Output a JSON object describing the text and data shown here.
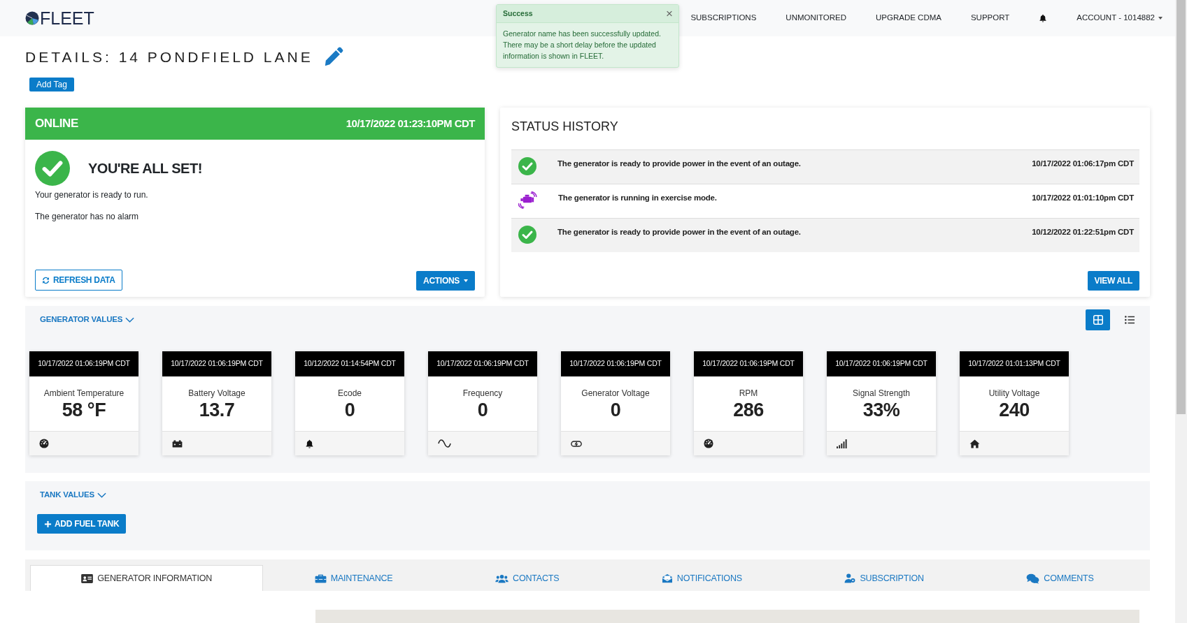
{
  "header": {
    "logo_text": "FLEET",
    "nav": [
      {
        "kind": "link",
        "label": "SUBSCRIPTIONS"
      },
      {
        "kind": "link",
        "label": "UNMONITORED"
      },
      {
        "kind": "link",
        "label": "UPGRADE CDMA"
      },
      {
        "kind": "link",
        "label": "SUPPORT"
      },
      {
        "kind": "bell"
      },
      {
        "kind": "dropdown",
        "label": "ACCOUNT - 1014882"
      }
    ]
  },
  "toast": {
    "title": "Success",
    "close": "×",
    "message": "Generator name has been successfully updated. There may be a short delay before the updated information is shown in FLEET."
  },
  "page": {
    "title": "DETAILS: 14 PONDFIELD LANE",
    "add_tag_button": "Add Tag"
  },
  "status_card": {
    "status": "ONLINE",
    "timestamp": "10/17/2022 01:23:10PM CDT",
    "headline": "YOU'RE ALL SET!",
    "messages": [
      "Your generator is ready to run.",
      "The generator has no alarm"
    ],
    "refresh_button": "REFRESH DATA",
    "actions_button": "ACTIONS"
  },
  "status_history": {
    "title": "STATUS HISTORY",
    "rows": [
      {
        "kind": "ready",
        "message": "The generator is ready to provide power in the event of an outage.",
        "time": "10/17/2022 01:06:17pm CDT"
      },
      {
        "kind": "exercise",
        "message": "The generator is running in exercise mode.",
        "time": "10/17/2022 01:01:10pm CDT"
      },
      {
        "kind": "ready",
        "message": "The generator is ready to provide power in the event of an outage.",
        "time": "10/12/2022 01:22:51pm CDT"
      }
    ],
    "view_all_button": "VIEW ALL"
  },
  "generator_values": {
    "title": "GENERATOR VALUES",
    "view_modes": [
      {
        "kind": "grid",
        "selected": true
      },
      {
        "kind": "list",
        "selected": false
      }
    ],
    "tiles": [
      {
        "kind": "gauge",
        "timestamp": "10/17/2022 01:06:19PM CDT",
        "label": "Ambient Temperature",
        "value": "58 °F"
      },
      {
        "kind": "battery",
        "timestamp": "10/17/2022 01:06:19PM CDT",
        "label": "Battery Voltage",
        "value": "13.7"
      },
      {
        "kind": "bell",
        "timestamp": "10/12/2022 01:14:54PM CDT",
        "label": "Ecode",
        "value": "0"
      },
      {
        "kind": "wave",
        "timestamp": "10/17/2022 01:06:19PM CDT",
        "label": "Frequency",
        "value": "0"
      },
      {
        "kind": "charge",
        "timestamp": "10/17/2022 01:06:19PM CDT",
        "label": "Generator Voltage",
        "value": "0"
      },
      {
        "kind": "gauge",
        "timestamp": "10/17/2022 01:06:19PM CDT",
        "label": "RPM",
        "value": "286"
      },
      {
        "kind": "signal",
        "timestamp": "10/17/2022 01:06:19PM CDT",
        "label": "Signal Strength",
        "value": "33%"
      },
      {
        "kind": "home",
        "timestamp": "10/17/2022 01:01:13PM CDT",
        "label": "Utility Voltage",
        "value": "240"
      }
    ]
  },
  "tank_values": {
    "title": "TANK VALUES",
    "add_button": "ADD FUEL TANK"
  },
  "tabs": [
    {
      "kind": "id-card",
      "label": "GENERATOR INFORMATION",
      "selected": true
    },
    {
      "kind": "toolbox",
      "label": "MAINTENANCE",
      "selected": false
    },
    {
      "kind": "users",
      "label": "CONTACTS",
      "selected": false
    },
    {
      "kind": "envelope",
      "label": "NOTIFICATIONS",
      "selected": false
    },
    {
      "kind": "user-gear",
      "label": "SUBSCRIPTION",
      "selected": false
    },
    {
      "kind": "comments",
      "label": "COMMENTS",
      "selected": false
    }
  ]
}
